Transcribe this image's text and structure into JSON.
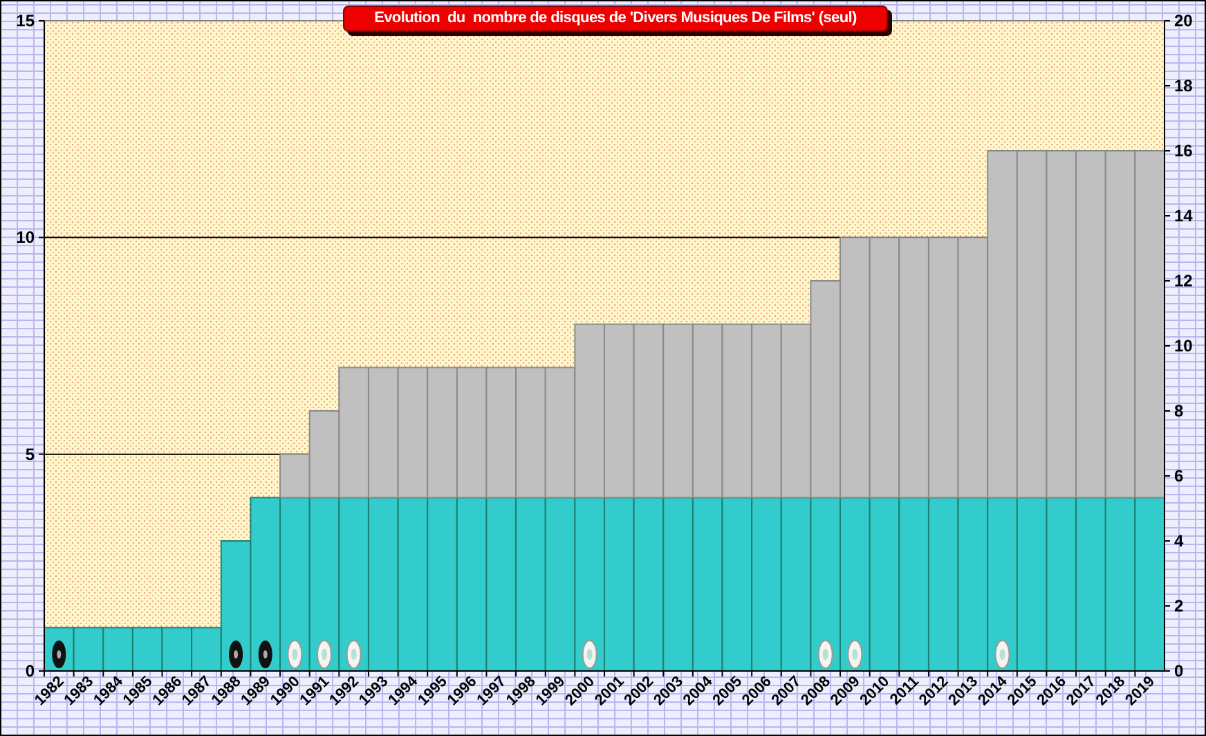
{
  "chart_data": {
    "type": "bar",
    "stacked": true,
    "title": "Evolution  du  nombre de disques de 'Divers Musiques De Films' (seul)",
    "categories": [
      "1982",
      "1983",
      "1984",
      "1985",
      "1986",
      "1987",
      "1988",
      "1989",
      "1990",
      "1991",
      "1992",
      "1993",
      "1994",
      "1995",
      "1996",
      "1997",
      "1998",
      "1999",
      "2000",
      "2001",
      "2002",
      "2003",
      "2004",
      "2005",
      "2006",
      "2007",
      "2008",
      "2009",
      "2010",
      "2011",
      "2012",
      "2013",
      "2014",
      "2015",
      "2016",
      "2017",
      "2018",
      "2019"
    ],
    "series": [
      {
        "color": "#33cccc",
        "values": [
          1,
          1,
          1,
          1,
          1,
          1,
          3,
          4,
          4,
          4,
          4,
          4,
          4,
          4,
          4,
          4,
          4,
          4,
          4,
          4,
          4,
          4,
          4,
          4,
          4,
          4,
          4,
          4,
          4,
          4,
          4,
          4,
          4,
          4,
          4,
          4,
          4,
          4
        ]
      },
      {
        "color": "#c0c0c0",
        "values": [
          0,
          0,
          0,
          0,
          0,
          0,
          0,
          0,
          1,
          2,
          3,
          3,
          3,
          3,
          3,
          3,
          3,
          3,
          4,
          4,
          4,
          4,
          4,
          4,
          4,
          4,
          5,
          6,
          6,
          6,
          6,
          6,
          8,
          8,
          8,
          8,
          8,
          8
        ]
      }
    ],
    "ylim": [
      0,
      15
    ],
    "yticks": [
      0,
      5,
      10,
      15
    ],
    "y2lim": [
      0,
      20
    ],
    "y2ticks": [
      0,
      2,
      4,
      6,
      8,
      10,
      12,
      14,
      16,
      18,
      20
    ]
  },
  "year_markers": [
    {
      "kind": "vinyl"
    },
    {
      "kind": "none"
    },
    {
      "kind": "none"
    },
    {
      "kind": "none"
    },
    {
      "kind": "none"
    },
    {
      "kind": "none"
    },
    {
      "kind": "vinyl"
    },
    {
      "kind": "vinyl"
    },
    {
      "kind": "cd"
    },
    {
      "kind": "cd"
    },
    {
      "kind": "cd"
    },
    {
      "kind": "none"
    },
    {
      "kind": "none"
    },
    {
      "kind": "none"
    },
    {
      "kind": "none"
    },
    {
      "kind": "none"
    },
    {
      "kind": "none"
    },
    {
      "kind": "none"
    },
    {
      "kind": "cd"
    },
    {
      "kind": "none"
    },
    {
      "kind": "none"
    },
    {
      "kind": "none"
    },
    {
      "kind": "none"
    },
    {
      "kind": "none"
    },
    {
      "kind": "none"
    },
    {
      "kind": "none"
    },
    {
      "kind": "cd"
    },
    {
      "kind": "cd"
    },
    {
      "kind": "none"
    },
    {
      "kind": "none"
    },
    {
      "kind": "none"
    },
    {
      "kind": "none"
    },
    {
      "kind": "cd"
    },
    {
      "kind": "none"
    },
    {
      "kind": "none"
    },
    {
      "kind": "none"
    },
    {
      "kind": "none"
    },
    {
      "kind": "none"
    }
  ]
}
